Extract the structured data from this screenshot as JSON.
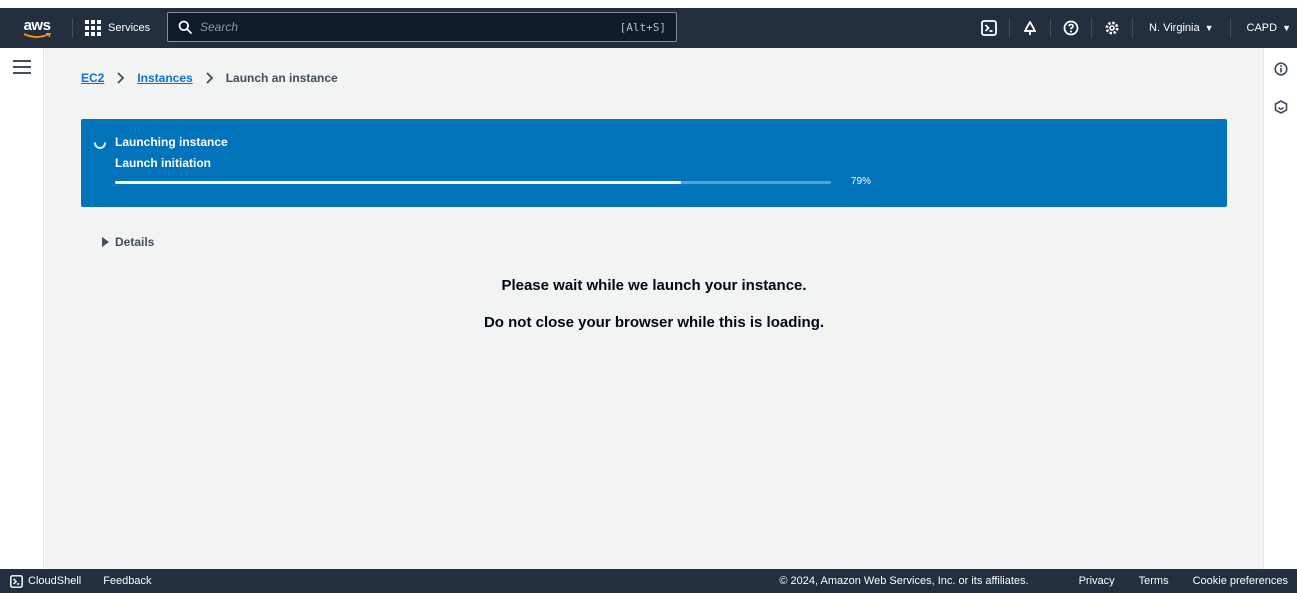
{
  "topnav": {
    "logo_text": "aws",
    "services_label": "Services",
    "search_placeholder": "Search",
    "search_shortcut": "[Alt+S]",
    "region_label": "N. Virginia",
    "account_label": "CAPD"
  },
  "breadcrumb": {
    "items": [
      "EC2",
      "Instances"
    ],
    "current": "Launch an instance"
  },
  "flash": {
    "title": "Launching instance",
    "subtitle": "Launch initiation",
    "progress_percent": 79,
    "progress_label": "79%",
    "background_color": "#0073bb"
  },
  "details": {
    "label": "Details"
  },
  "messages": {
    "line1": "Please wait while we launch your instance.",
    "line2": "Do not close your browser while this is loading."
  },
  "footer": {
    "cloudshell_label": "CloudShell",
    "feedback_label": "Feedback",
    "copyright": "© 2024, Amazon Web Services, Inc. or its affiliates.",
    "links": [
      "Privacy",
      "Terms",
      "Cookie preferences"
    ]
  },
  "icons": {
    "nav": [
      "cloudshell-icon",
      "bell-icon",
      "help-icon",
      "settings-icon"
    ],
    "rail": [
      "info-icon",
      "hexagon-icon"
    ]
  }
}
